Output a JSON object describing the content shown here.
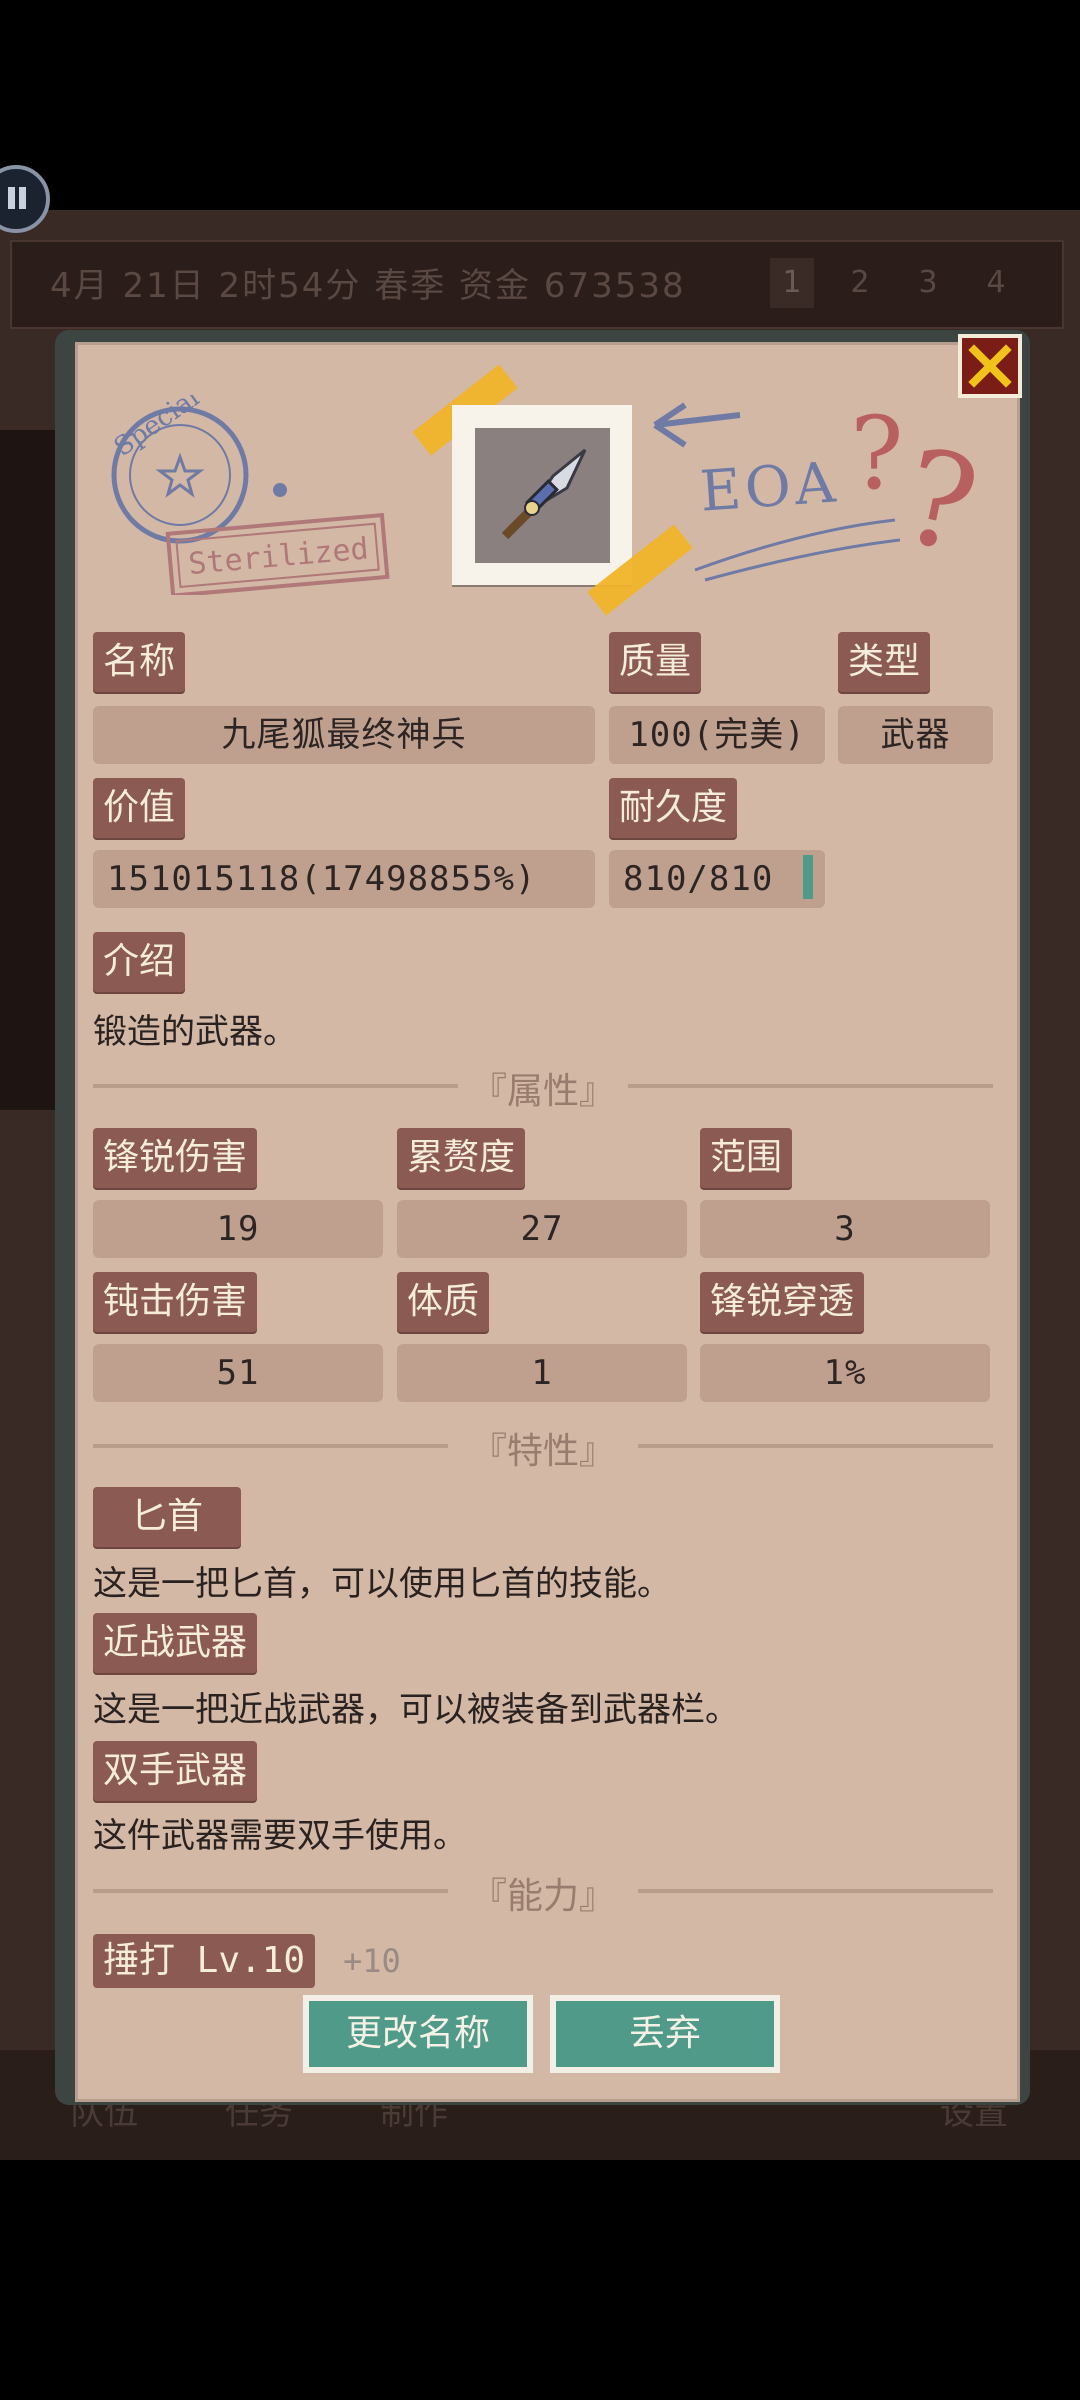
{
  "background": {
    "topbar": {
      "date_text": "4月  21日  2时54分  春季 资金 673538",
      "pages": [
        "1",
        "2",
        "3",
        "4"
      ]
    },
    "nav": [
      "队伍",
      "任务",
      "制作",
      "设置"
    ]
  },
  "decor": {
    "stamp_word": "Special",
    "stamp_label": "Sterilized",
    "eoa": "EOA",
    "question_mark": "?"
  },
  "item": {
    "name_label": "名称",
    "name_value": "九尾狐最终神兵",
    "quality_label": "质量",
    "quality_value": "100(完美)",
    "type_label": "类型",
    "type_value": "武器",
    "value_label": "价值",
    "value_value": "151015118(17498855%)",
    "durability_label": "耐久度",
    "durability_value": "810/810",
    "durability_fraction": 1.0,
    "intro_label": "介绍",
    "intro_text": "锻造的武器。"
  },
  "attributes": {
    "title": "『属性』",
    "stats": [
      {
        "label": "锋锐伤害",
        "value": "19"
      },
      {
        "label": "累赘度",
        "value": "27"
      },
      {
        "label": "范围",
        "value": "3"
      },
      {
        "label": "钝击伤害",
        "value": "51"
      },
      {
        "label": "体质",
        "value": "1"
      },
      {
        "label": "锋锐穿透",
        "value": "1%"
      }
    ]
  },
  "traits": {
    "title": "『特性』",
    "items": [
      {
        "label": "匕首",
        "desc": "这是一把匕首，可以使用匕首的技能。"
      },
      {
        "label": "近战武器",
        "desc": "这是一把近战武器，可以被装备到武器栏。"
      },
      {
        "label": "双手武器",
        "desc": "这件武器需要双手使用。"
      }
    ]
  },
  "abilities": {
    "title": "『能力』",
    "skill": "捶打 Lv.10",
    "bonus": "+10"
  },
  "buttons": {
    "rename": "更改名称",
    "discard": "丢弃"
  },
  "colors": {
    "paper": "#d3b8a6",
    "label_bg": "#8b5a52",
    "field_bg": "#bfa08f",
    "button": "#4f9a88",
    "close": "#7a1d17",
    "tape": "#f0b42a"
  }
}
